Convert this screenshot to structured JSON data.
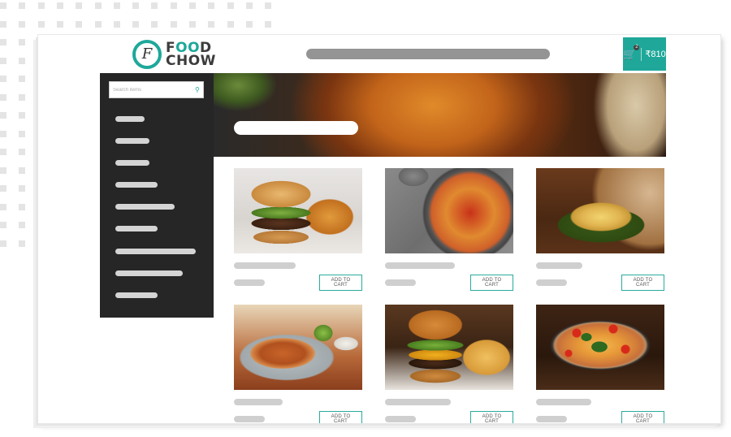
{
  "brand": {
    "logo_letter": "F",
    "name_line1_a": "F",
    "name_line1_b": "OO",
    "name_line1_c": "D",
    "name_line2": "CHOW",
    "accent_color": "#1ea89a"
  },
  "header": {
    "search_placeholder_bar": "",
    "cart": {
      "icon": "cart-icon",
      "count": "2",
      "total": "₹810"
    }
  },
  "sidebar": {
    "search_placeholder": "Search items",
    "search_icon": "search-icon",
    "items": [
      {
        "label": ""
      },
      {
        "label": ""
      },
      {
        "label": ""
      },
      {
        "label": ""
      },
      {
        "label": ""
      },
      {
        "label": ""
      },
      {
        "label": ""
      },
      {
        "label": ""
      },
      {
        "label": ""
      }
    ]
  },
  "banner": {
    "title": ""
  },
  "products": [
    {
      "image": "burger-with-fries",
      "name": "",
      "price": "",
      "button_label": "ADD TO CART"
    },
    {
      "image": "penne-pasta",
      "name": "",
      "price": "",
      "button_label": "ADD TO CART"
    },
    {
      "image": "noodles-on-leaf",
      "name": "",
      "price": "",
      "button_label": "ADD TO CART"
    },
    {
      "image": "chicken-wings",
      "name": "",
      "price": "",
      "button_label": "ADD TO CART"
    },
    {
      "image": "cheeseburger-with-fries",
      "name": "",
      "price": "",
      "button_label": "ADD TO CART"
    },
    {
      "image": "pizza",
      "name": "",
      "price": "",
      "button_label": "ADD TO CART"
    }
  ]
}
